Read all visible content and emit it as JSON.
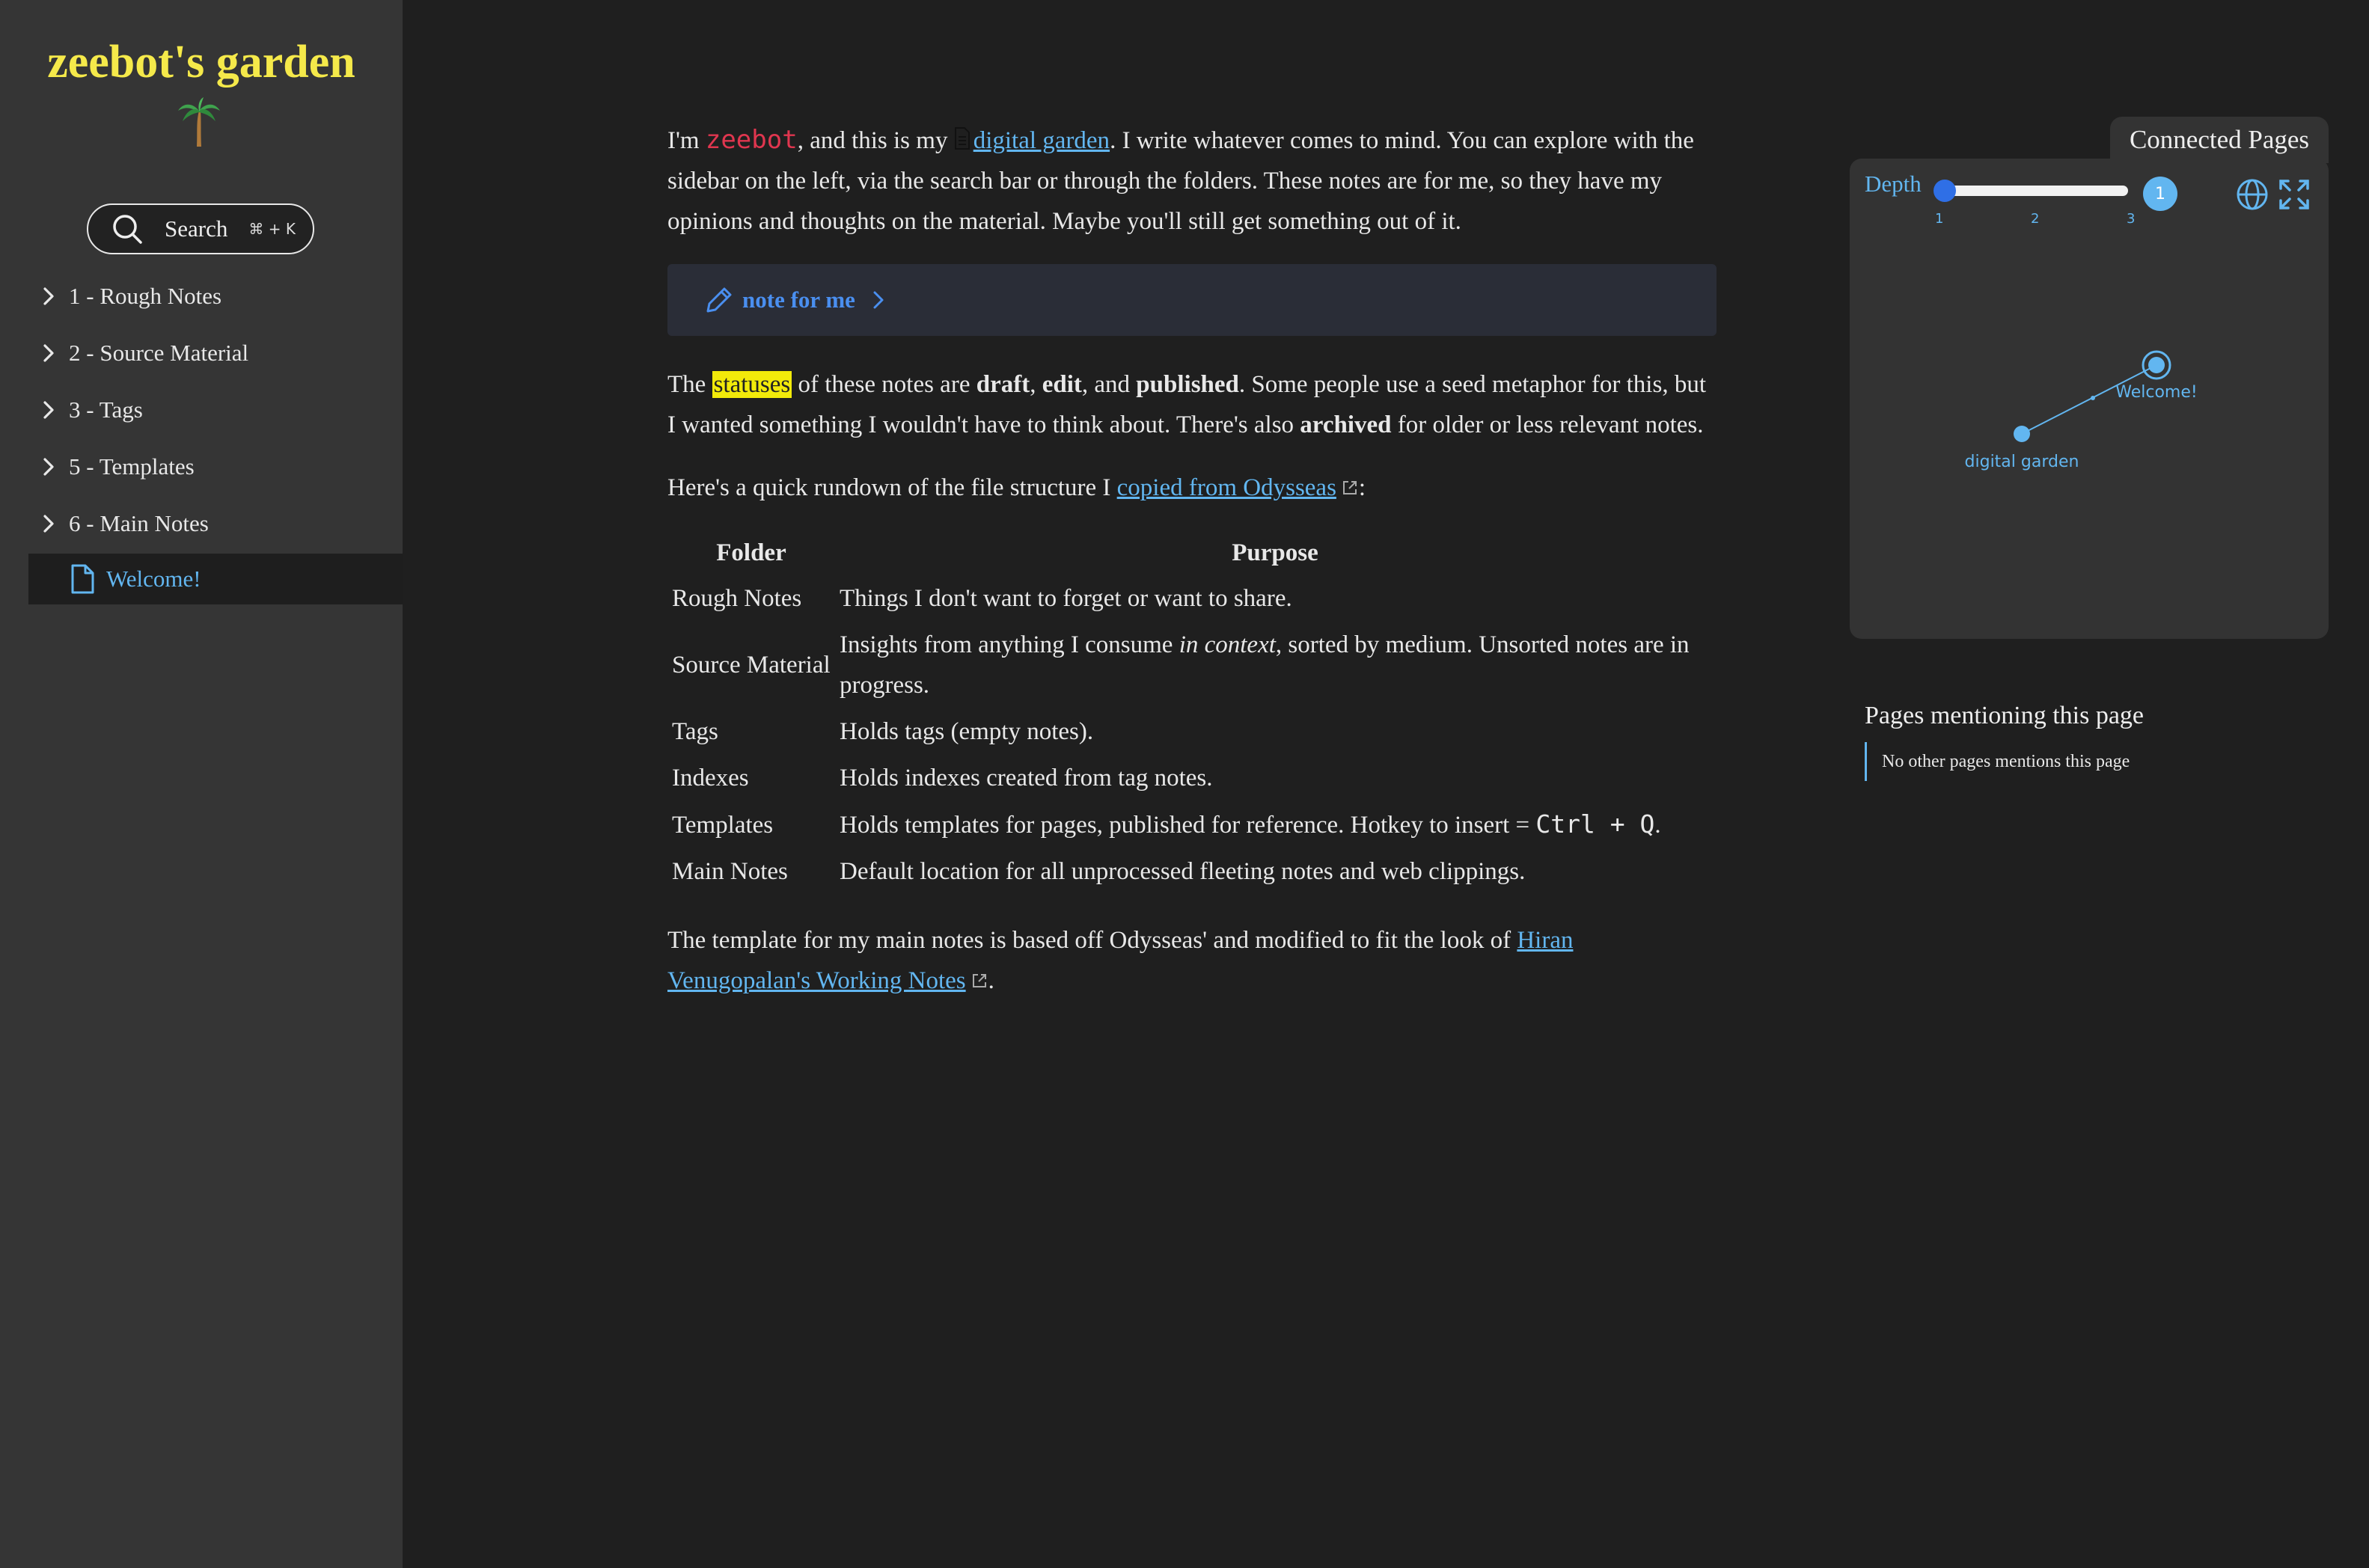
{
  "sidebar": {
    "title": "zeebot's garden",
    "search": {
      "label": "Search",
      "shortcut": "⌘ + K"
    },
    "items": [
      {
        "label": "1 - Rough Notes"
      },
      {
        "label": "2 - Source Material"
      },
      {
        "label": "3 - Tags"
      },
      {
        "label": "5 - Templates"
      },
      {
        "label": "6 - Main Notes"
      }
    ],
    "active_item": {
      "label": "Welcome!"
    }
  },
  "content": {
    "intro": {
      "t1": "I'm ",
      "code": "zeebot",
      "t2": ", and this is my ",
      "link": "digital garden",
      "t3": ". I write whatever comes to mind. You can explore with the sidebar on the left, via the search bar or through the folders. These notes are for me, so they have my opinions and thoughts on the material. Maybe you'll still get something out of it."
    },
    "callout": {
      "title": "note for me"
    },
    "statuses": {
      "t1": "The ",
      "highlight": "statuses",
      "t2": " of these notes are ",
      "b1": "draft",
      "t3": ", ",
      "b2": "edit",
      "t4": ", and ",
      "b3": "published",
      "t5": ". Some people use a seed metaphor for this, but I wanted something I wouldn't have to think about. There's also ",
      "b4": "archived",
      "t6": " for older or less relevant notes."
    },
    "rundown": {
      "t1": "Here's a quick rundown of the file structure I ",
      "link": "copied from Odysseas",
      "t2": ":"
    },
    "table": {
      "headers": [
        "Folder",
        "Purpose"
      ],
      "rows": [
        {
          "folder": "Rough Notes",
          "purpose": "Things I don't want to forget or want to share."
        },
        {
          "folder": "Source Material",
          "p1": "Insights from anything I consume ",
          "em": "in context",
          "p2": ", sorted by medium. Unsorted notes are in progress."
        },
        {
          "folder": "Tags",
          "purpose": "Holds tags (empty notes)."
        },
        {
          "folder": "Indexes",
          "purpose": "Holds indexes created from tag notes."
        },
        {
          "folder": "Templates",
          "p1": "Holds templates for pages, published for reference. Hotkey to insert = ",
          "code": "Ctrl + Q",
          "p2": "."
        },
        {
          "folder": "Main Notes",
          "purpose": "Default location for all unprocessed fleeting notes and web clippings."
        }
      ]
    },
    "footer": {
      "t1": "The template for my main notes is based off Odysseas' and modified to fit the look of ",
      "link": "Hiran Venugopalan's Working Notes",
      "t2": "."
    }
  },
  "graph": {
    "tab": "Connected Pages",
    "depth_label": "Depth",
    "depth_value": "1",
    "ticks": [
      "1",
      "2",
      "3"
    ],
    "nodes": [
      {
        "label": "Welcome!",
        "current": true
      },
      {
        "label": "digital garden",
        "current": false
      }
    ]
  },
  "backlinks": {
    "title": "Pages mentioning this page",
    "empty": "No other pages mentions this page"
  },
  "colors": {
    "accent": "#62b6f0",
    "title": "#f5e94a",
    "highlight": "#f2ea0a",
    "code": "#e0364f"
  }
}
